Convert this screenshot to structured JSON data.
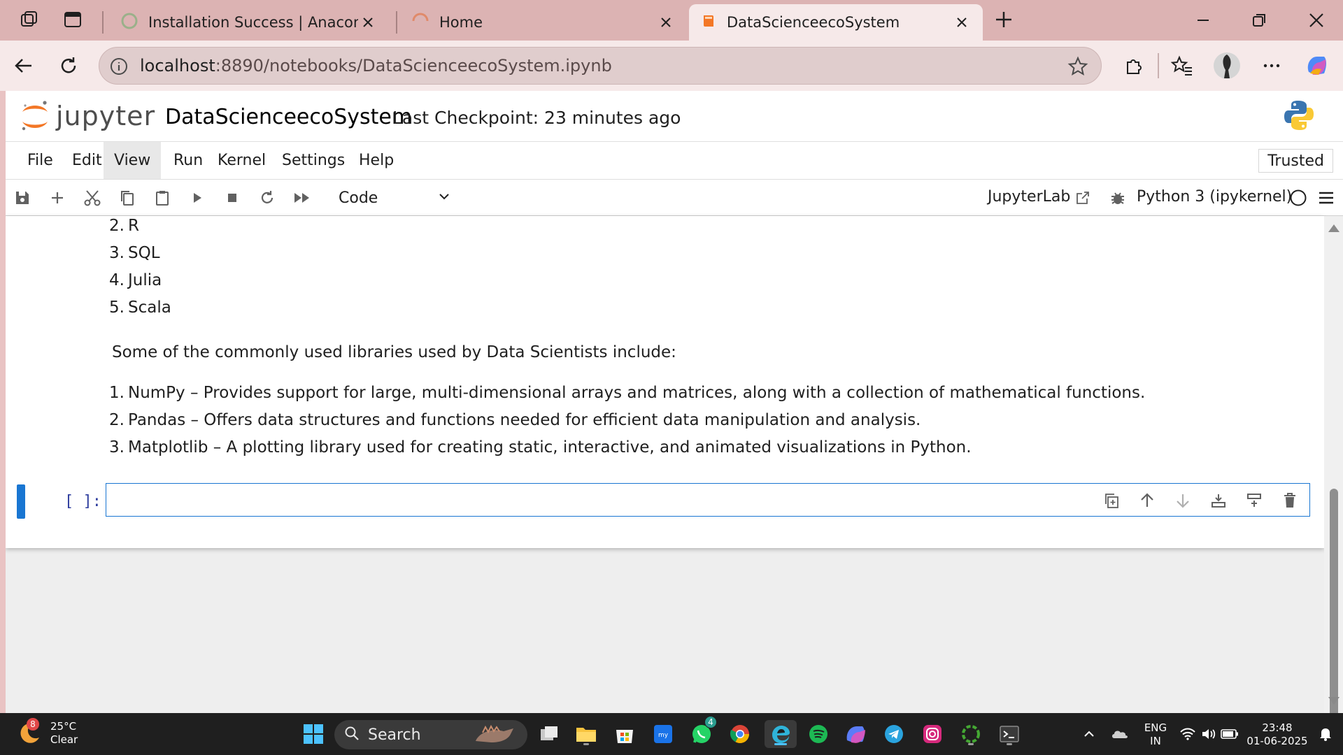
{
  "browser": {
    "tabs": [
      {
        "title": "Installation Success | Anaconda",
        "active": false
      },
      {
        "title": "Home",
        "active": false
      },
      {
        "title": "DataScienceecoSystem",
        "active": true
      }
    ],
    "url_host": "localhost",
    "url_path": ":8890/notebooks/DataScienceecoSystem.ipynb"
  },
  "jupyter": {
    "logo_text": "jupyter",
    "notebook_title": "DataScienceecoSystem",
    "checkpoint": "Last Checkpoint: 23 minutes ago",
    "menu": [
      "File",
      "Edit",
      "View",
      "Run",
      "Kernel",
      "Settings",
      "Help"
    ],
    "trusted": "Trusted",
    "cell_type": "Code",
    "jupyterlab_link": "JupyterLab",
    "kernel": "Python 3 (ipykernel)"
  },
  "notebook": {
    "languages": [
      {
        "num": "2.",
        "text": "R"
      },
      {
        "num": "3.",
        "text": "SQL"
      },
      {
        "num": "4.",
        "text": "Julia"
      },
      {
        "num": "5.",
        "text": "Scala"
      }
    ],
    "libraries_intro": "Some of the commonly used libraries used by Data Scientists include:",
    "libraries": [
      {
        "num": "1.",
        "text": "NumPy – Provides support for large, multi-dimensional arrays and matrices, along with a collection of mathematical functions."
      },
      {
        "num": "2.",
        "text": "Pandas – Offers data structures and functions needed for efficient data manipulation and analysis."
      },
      {
        "num": "3.",
        "text": "Matplotlib – A plotting library used for creating static, interactive, and animated visualizations in Python."
      }
    ],
    "empty_prompt": "[ ]:"
  },
  "taskbar": {
    "weather_badge": "8",
    "temperature": "25°C",
    "condition": "Clear",
    "search_label": "Search",
    "whatsapp_badge": "4",
    "lang_line1": "ENG",
    "lang_line2": "IN",
    "time": "23:48",
    "date": "01-06-2025"
  },
  "colors": {
    "tabstrip": "#dcb3b3",
    "accent_blue": "#1976d2",
    "jupyter_orange": "#f37726"
  }
}
